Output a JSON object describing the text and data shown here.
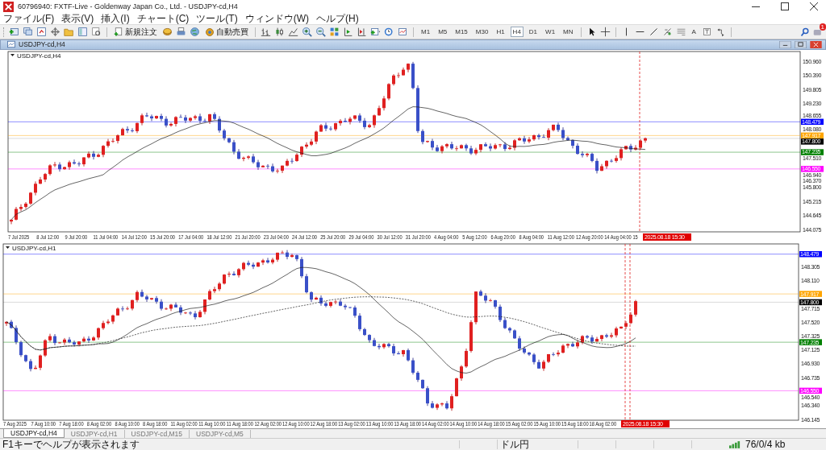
{
  "window": {
    "title": "60796940: FXTF-Live - Goldenway Japan Co., Ltd. - USDJPY-cd,H4"
  },
  "menu": [
    "ファイル(F)",
    "表示(V)",
    "挿入(I)",
    "チャート(C)",
    "ツール(T)",
    "ウィンドウ(W)",
    "ヘルプ(H)"
  ],
  "toolbar": {
    "order_button": "新規注文",
    "auto_trading_button": "自動売買",
    "text_tool": "A",
    "notification_count": "1",
    "timeframes": [
      {
        "label": "M1",
        "selected": false
      },
      {
        "label": "M5",
        "selected": false
      },
      {
        "label": "M15",
        "selected": false
      },
      {
        "label": "M30",
        "selected": false
      },
      {
        "label": "H1",
        "selected": false
      },
      {
        "label": "H4",
        "selected": true
      },
      {
        "label": "D1",
        "selected": false
      },
      {
        "label": "W1",
        "selected": false
      },
      {
        "label": "MN",
        "selected": false
      }
    ]
  },
  "chart_window": {
    "title": "USDJPY-cd,H4"
  },
  "charts": [
    {
      "label": "USDJPY-cd,H4",
      "price_ticks": [
        "150.960",
        "150.390",
        "149.805",
        "149.230",
        "148.655",
        "148.080",
        "147.510",
        "146.940",
        "146.370",
        "145.800",
        "145.215",
        "144.645",
        "144.075"
      ],
      "price_tags": [
        {
          "text": "148.479",
          "color": "#0000ff"
        },
        {
          "text": "147.917",
          "color": "#ffa500"
        },
        {
          "text": "147.800",
          "color": "#000000"
        },
        {
          "text": "147.235",
          "color": "#008000"
        },
        {
          "text": "146.550",
          "color": "#ff00ff"
        }
      ],
      "time_labels": [
        "7 Jul 2025",
        "8 Jul 12:00",
        "9 Jul 20:00",
        "11 Jul 04:00",
        "14 Jul 12:00",
        "15 Jul 20:00",
        "17 Jul 04:00",
        "18 Jul 12:00",
        "21 Jul 20:00",
        "23 Jul 04:00",
        "24 Jul 12:00",
        "25 Jul 20:00",
        "29 Jul 04:00",
        "30 Jul 12:00",
        "31 Jul 20:00",
        "4 Aug 04:00",
        "5 Aug 12:00",
        "6 Aug 20:00",
        "8 Aug 04:00",
        "11 Aug 12:00",
        "12 Aug 20:00",
        "14 Aug 04:00",
        "15"
      ],
      "time_tag": "2025.08.18 15:30"
    },
    {
      "label": "USDJPY-cd,H1",
      "price_ticks": [
        "148.305",
        "148.110",
        "147.715",
        "147.520",
        "147.325",
        "147.125",
        "146.930",
        "146.735",
        "146.540",
        "146.340",
        "146.145"
      ],
      "price_tags": [
        {
          "text": "148.479",
          "color": "#0000ff"
        },
        {
          "text": "147.917",
          "color": "#ffa500"
        },
        {
          "text": "147.800",
          "color": "#000000"
        },
        {
          "text": "147.235",
          "color": "#008000"
        },
        {
          "text": "146.550",
          "color": "#ff00ff"
        }
      ],
      "time_labels": [
        "7 Aug 2025",
        "7 Aug 10:00",
        "7 Aug 18:00",
        "8 Aug 02:00",
        "8 Aug 10:00",
        "8 Aug 18:00",
        "11 Aug 02:00",
        "11 Aug 10:00",
        "11 Aug 18:00",
        "12 Aug 02:00",
        "12 Aug 10:00",
        "12 Aug 18:00",
        "13 Aug 02:00",
        "13 Aug 10:00",
        "13 Aug 18:00",
        "14 Aug 02:00",
        "14 Aug 10:00",
        "14 Aug 18:00",
        "15 Aug 02:00",
        "15 Aug 10:00",
        "15 Aug 18:00",
        "18 Aug 02:00"
      ],
      "time_tag": "2025.08.18 15:30"
    }
  ],
  "tabs": [
    {
      "label": "USDJPY-cd,H4",
      "selected": true
    },
    {
      "label": "USDJPY-cd,H1",
      "selected": false
    },
    {
      "label": "USDJPY-cd,M15",
      "selected": false
    },
    {
      "label": "USDJPY-cd,M5",
      "selected": false
    }
  ],
  "status_bar": {
    "help": "F1キーでヘルプが表示されます",
    "symbol": "ドル円",
    "traffic": "76/0/4 kb"
  }
}
